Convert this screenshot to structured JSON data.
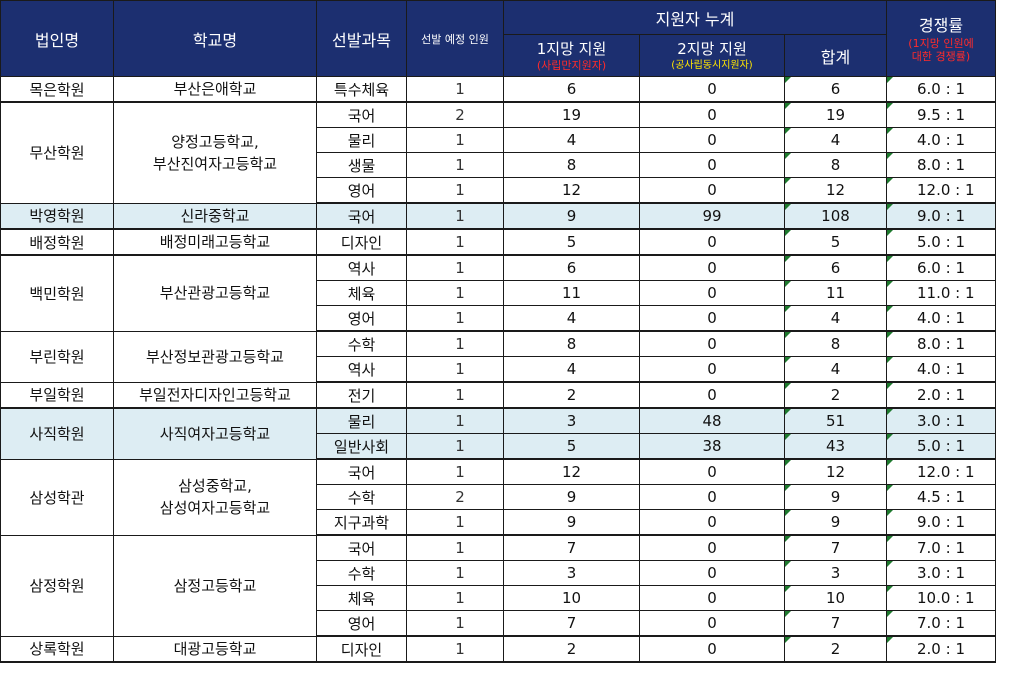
{
  "header": {
    "corp": "법인명",
    "school": "학교명",
    "subject": "선발과목",
    "quota": "선발 예정 인원",
    "applicants": "지원자 누계",
    "first_choice": "1지망 지원",
    "first_choice_note": "(사립만지원자)",
    "second_choice": "2지망 지원",
    "second_choice_note": "(공사립동시지원자)",
    "total": "합계",
    "ratio": "경쟁률",
    "ratio_note1": "(1지망 인원에",
    "ratio_note2": "대한 경쟁률)"
  },
  "groups": [
    {
      "corp": "목은학원",
      "school_lines": [
        "부산은애학교"
      ],
      "rows": [
        {
          "subject": "특수체육",
          "quota": "1",
          "first": "6",
          "second": "0",
          "total": "6",
          "ratio": "6.0 : 1"
        }
      ]
    },
    {
      "corp": "무산학원",
      "school_lines": [
        "양정고등학교,",
        "부산진여자고등학교"
      ],
      "rows": [
        {
          "subject": "국어",
          "quota": "2",
          "first": "19",
          "second": "0",
          "total": "19",
          "ratio": "9.5 : 1"
        },
        {
          "subject": "물리",
          "quota": "1",
          "first": "4",
          "second": "0",
          "total": "4",
          "ratio": "4.0 : 1"
        },
        {
          "subject": "생물",
          "quota": "1",
          "first": "8",
          "second": "0",
          "total": "8",
          "ratio": "8.0 : 1"
        },
        {
          "subject": "영어",
          "quota": "1",
          "first": "12",
          "second": "0",
          "total": "12",
          "ratio": "12.0 : 1"
        }
      ]
    },
    {
      "corp": "박영학원",
      "school_lines": [
        "신라중학교"
      ],
      "highlight": true,
      "rows": [
        {
          "subject": "국어",
          "quota": "1",
          "first": "9",
          "second": "99",
          "total": "108",
          "ratio": "9.0 : 1"
        }
      ]
    },
    {
      "corp": "배정학원",
      "school_lines": [
        "배정미래고등학교"
      ],
      "rows": [
        {
          "subject": "디자인",
          "quota": "1",
          "first": "5",
          "second": "0",
          "total": "5",
          "ratio": "5.0 : 1"
        }
      ]
    },
    {
      "corp": "백민학원",
      "school_lines": [
        "부산관광고등학교"
      ],
      "rows": [
        {
          "subject": "역사",
          "quota": "1",
          "first": "6",
          "second": "0",
          "total": "6",
          "ratio": "6.0 : 1"
        },
        {
          "subject": "체육",
          "quota": "1",
          "first": "11",
          "second": "0",
          "total": "11",
          "ratio": "11.0 : 1"
        },
        {
          "subject": "영어",
          "quota": "1",
          "first": "4",
          "second": "0",
          "total": "4",
          "ratio": "4.0 : 1"
        }
      ]
    },
    {
      "corp": "부린학원",
      "school_lines": [
        "부산정보관광고등학교"
      ],
      "rows": [
        {
          "subject": "수학",
          "quota": "1",
          "first": "8",
          "second": "0",
          "total": "8",
          "ratio": "8.0 : 1"
        },
        {
          "subject": "역사",
          "quota": "1",
          "first": "4",
          "second": "0",
          "total": "4",
          "ratio": "4.0 : 1"
        }
      ]
    },
    {
      "corp": "부일학원",
      "school_lines": [
        "부일전자디자인고등학교"
      ],
      "rows": [
        {
          "subject": "전기",
          "quota": "1",
          "first": "2",
          "second": "0",
          "total": "2",
          "ratio": "2.0 : 1"
        }
      ]
    },
    {
      "corp": "사직학원",
      "school_lines": [
        "사직여자고등학교"
      ],
      "highlight": true,
      "rows": [
        {
          "subject": "물리",
          "quota": "1",
          "first": "3",
          "second": "48",
          "total": "51",
          "ratio": "3.0 : 1"
        },
        {
          "subject": "일반사회",
          "quota": "1",
          "first": "5",
          "second": "38",
          "total": "43",
          "ratio": "5.0 : 1"
        }
      ]
    },
    {
      "corp": "삼성학관",
      "school_lines": [
        "삼성중학교,",
        "삼성여자고등학교"
      ],
      "rows": [
        {
          "subject": "국어",
          "quota": "1",
          "first": "12",
          "second": "0",
          "total": "12",
          "ratio": "12.0 : 1"
        },
        {
          "subject": "수학",
          "quota": "2",
          "first": "9",
          "second": "0",
          "total": "9",
          "ratio": "4.5 : 1"
        },
        {
          "subject": "지구과학",
          "quota": "1",
          "first": "9",
          "second": "0",
          "total": "9",
          "ratio": "9.0 : 1"
        }
      ]
    },
    {
      "corp": "삼정학원",
      "school_lines": [
        "삼정고등학교"
      ],
      "rows": [
        {
          "subject": "국어",
          "quota": "1",
          "first": "7",
          "second": "0",
          "total": "7",
          "ratio": "7.0 : 1"
        },
        {
          "subject": "수학",
          "quota": "1",
          "first": "3",
          "second": "0",
          "total": "3",
          "ratio": "3.0 : 1"
        },
        {
          "subject": "체육",
          "quota": "1",
          "first": "10",
          "second": "0",
          "total": "10",
          "ratio": "10.0 : 1"
        },
        {
          "subject": "영어",
          "quota": "1",
          "first": "7",
          "second": "0",
          "total": "7",
          "ratio": "7.0 : 1"
        }
      ]
    },
    {
      "corp": "상록학원",
      "school_lines": [
        "대광고등학교"
      ],
      "rows": [
        {
          "subject": "디자인",
          "quota": "1",
          "first": "2",
          "second": "0",
          "total": "2",
          "ratio": "2.0 : 1"
        }
      ]
    }
  ]
}
